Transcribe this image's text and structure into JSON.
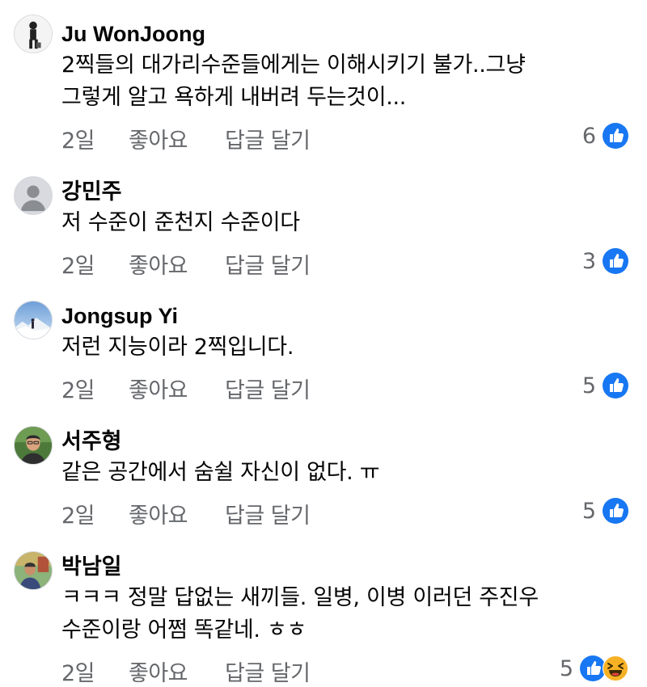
{
  "comments": [
    {
      "author": "Ju WonJoong",
      "text_lines": [
        "2찍들의 대가리수준들에게는 이해시키기 불가..그냥",
        "그렇게 알고 욕하게 내버려 두는것이..."
      ],
      "time": "2일",
      "like_label": "좋아요",
      "reply_label": "답글 달기",
      "reaction_count": "6",
      "reactions": [
        "like-icon"
      ]
    },
    {
      "author": "강민주",
      "text_lines": [
        "저 수준이 준천지 수준이다"
      ],
      "time": "2일",
      "like_label": "좋아요",
      "reply_label": "답글 달기",
      "reaction_count": "3",
      "reactions": [
        "like-icon"
      ]
    },
    {
      "author": "Jongsup Yi",
      "text_lines": [
        "저런 지능이라 2찍입니다."
      ],
      "time": "2일",
      "like_label": "좋아요",
      "reply_label": "답글 달기",
      "reaction_count": "5",
      "reactions": [
        "like-icon"
      ]
    },
    {
      "author": "서주형",
      "text_lines": [
        "같은 공간에서 숨쉴 자신이 없다. ㅠ"
      ],
      "time": "2일",
      "like_label": "좋아요",
      "reply_label": "답글 달기",
      "reaction_count": "5",
      "reactions": [
        "like-icon"
      ]
    },
    {
      "author": "박남일",
      "text_lines": [
        "ㅋㅋㅋ 정말 답없는 새끼들. 일병, 이병 이러던 주진우",
        "수준이랑 어쩜 똑같네. ㅎㅎ"
      ],
      "time": "2일",
      "like_label": "좋아요",
      "reply_label": "답글 달기",
      "reaction_count": "5",
      "reactions": [
        "like-icon",
        "laugh-icon"
      ]
    }
  ],
  "colors": {
    "like_blue": "#1877f2",
    "meta_gray": "#65676b",
    "laugh_yellow": "#f7b125"
  }
}
